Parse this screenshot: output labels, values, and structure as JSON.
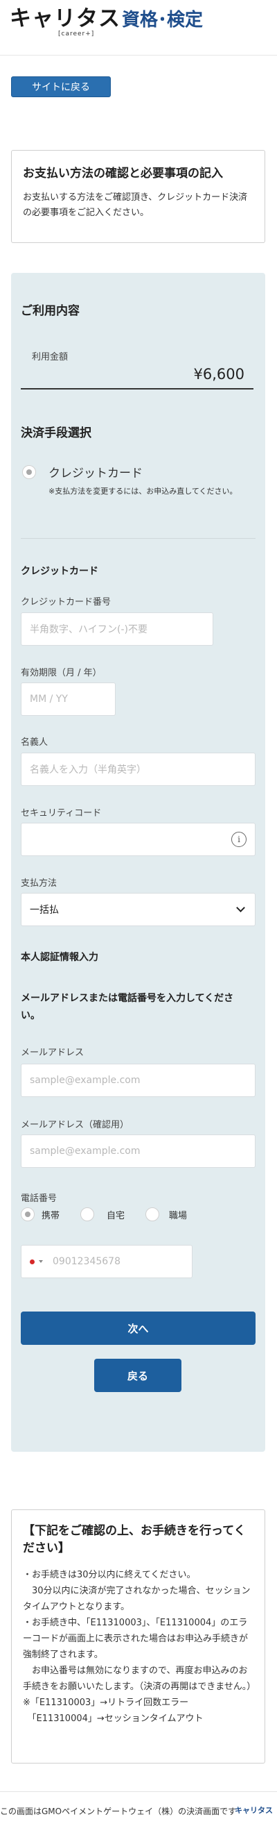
{
  "header": {
    "logo_main": "キャリタス",
    "logo_sub": "資格･検定",
    "logo_tag": "[career+]"
  },
  "back_to_site_label": "サイトに戻る",
  "intro": {
    "title": "お支払い方法の確認と必要事項の記入",
    "text": "お支払いする方法をご確認頂き、クレジットカード決済の必要事項をご記入ください。"
  },
  "usage": {
    "heading": "ご利用内容",
    "amount_label": "利用金額",
    "amount": "¥6,600"
  },
  "payment_method": {
    "heading": "決済手段選択",
    "option_label": "クレジットカード",
    "note": "※支払方法を変更するには、お申込み直してください。"
  },
  "card": {
    "heading": "クレジットカード",
    "number_label": "クレジットカード番号",
    "number_placeholder": "半角数字、ハイフン(-)不要",
    "expiry_label": "有効期限（月 / 年）",
    "expiry_placeholder": "MM / YY",
    "holder_label": "名義人",
    "holder_placeholder": "名義人を入力（半角英字）",
    "security_label": "セキュリティコード",
    "security_placeholder": "",
    "installment_label": "支払方法",
    "installment_value": "一括払"
  },
  "auth": {
    "heading": "本人認証情報入力",
    "instruction": "メールアドレスまたは電話番号を入力してください。",
    "email_label": "メールアドレス",
    "email_placeholder": "sample@example.com",
    "email_confirm_label": "メールアドレス（確認用）",
    "email_confirm_placeholder": "sample@example.com",
    "phone_label": "電話番号",
    "phone_types": [
      "携帯",
      "自宅",
      "職場"
    ],
    "phone_placeholder": "09012345678"
  },
  "buttons": {
    "next": "次へ",
    "back": "戻る"
  },
  "notice": {
    "title": "【下記をご確認の上、お手続きを行ってください】",
    "lines": [
      "・お手続きは30分以内に終えてください。",
      "　30分以内に決済が完了されなかった場合、セッションタイムアウトとなります。",
      "・お手続き中、「E11310003」、「E11310004」のエラーコードが画面上に表示された場合はお申込み手続きが強制終了されます。",
      "　お申込番号は無効になりますので、再度お申込みのお手続きをお願いいたします。（決済の再開はできません。）",
      "※「E11310003」→リトライ回数エラー",
      "　「E11310004」→セッションタイムアウト"
    ]
  },
  "footer": {
    "text": "この画面はGMOペイメントゲートウェイ（株）の決済画面です",
    "logo": "キャリタス"
  },
  "colors": {
    "primary": "#1d5f9e",
    "panel_bg": "#e2ecef",
    "brand_blue": "#1f4e8c"
  }
}
